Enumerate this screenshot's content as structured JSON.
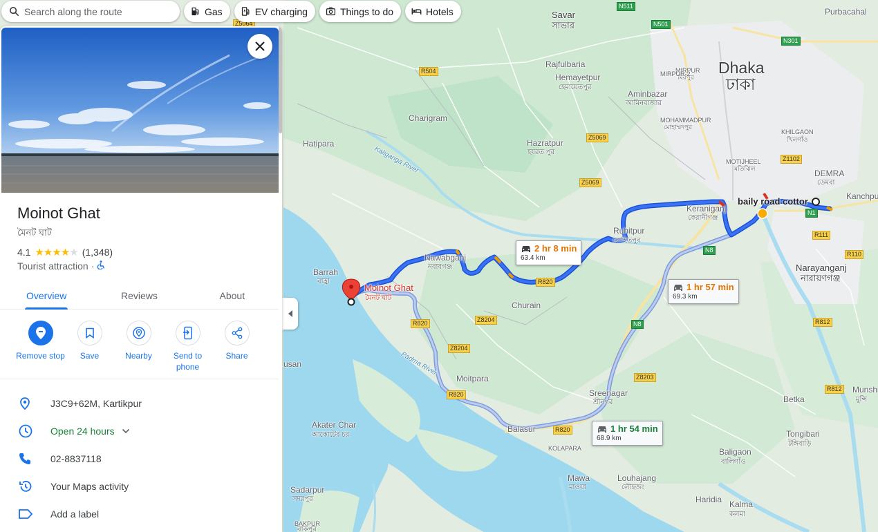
{
  "search": {
    "placeholder": "Search along the route"
  },
  "chips": [
    {
      "label": "Gas",
      "icon": "gas-station-icon"
    },
    {
      "label": "EV charging",
      "icon": "ev-charging-icon"
    },
    {
      "label": "Things to do",
      "icon": "camera-icon"
    },
    {
      "label": "Hotels",
      "icon": "bed-icon"
    }
  ],
  "place": {
    "title": "Moinot Ghat",
    "subtitle": "মৈনট ঘাট",
    "rating": "4.1",
    "stars": 4,
    "reviews_count": "(1,348)",
    "category": "Tourist attraction",
    "separator": "·"
  },
  "tabs": [
    {
      "label": "Overview",
      "active": true
    },
    {
      "label": "Reviews",
      "active": false
    },
    {
      "label": "About",
      "active": false
    }
  ],
  "actions": [
    {
      "label": "Remove stop",
      "icon": "remove-stop-icon"
    },
    {
      "label": "Save",
      "icon": "bookmark-icon"
    },
    {
      "label": "Nearby",
      "icon": "nearby-icon"
    },
    {
      "label": "Send to phone",
      "icon": "send-to-phone-icon"
    },
    {
      "label": "Share",
      "icon": "share-icon"
    }
  ],
  "info": {
    "address": "J3C9+62M, Kartikpur",
    "hours": "Open 24 hours",
    "phone": "02-8837118",
    "activity": "Your Maps activity",
    "label": "Add a label"
  },
  "routes": [
    {
      "time": "2 hr 8 min",
      "distance": "63.4 km"
    },
    {
      "time": "1 hr 57 min",
      "distance": "69.3 km"
    },
    {
      "time": "1 hr 54 min",
      "distance": "68.9 km"
    }
  ],
  "map": {
    "places": {
      "savar": "Savar",
      "savar_bn": "সাভার",
      "rajfulbaria": "Rajfulbaria",
      "hemayetpur": "Hemayetpur",
      "hemayetpur_bn": "হেমায়েতপুর",
      "aminbazar": "Aminbazar",
      "aminbazar_bn": "আমিনবাজার",
      "mohammadpur": "MOHAMMADPUR",
      "mohammadpur_bn": "মোহাম্মদপুর",
      "mirpur": "MIRPUR",
      "mirpur_bn": "মিরপুর",
      "mirpur2": "MIRPUR-2",
      "dhaka": "Dhaka",
      "dhaka_bn": "ঢাকা",
      "purbacahal": "Purbacahal",
      "khilgaon": "KHILGAON",
      "khilgaon_bn": "খিলগাঁও",
      "motijheel": "MOTIJHEEL",
      "motijheel_bn": "মতিঝিল",
      "demra": "DEMRA",
      "demra_bn": "ডেমরা",
      "kanchpur": "Kanchpu",
      "charigram": "Charigram",
      "hazratpur": "Hazratpur",
      "hazratpur_bn": "হযরত পুর",
      "hatipara": "Hatipara",
      "keraniganj": "Keraniganj",
      "keraniganj_bn": "কেরানীগঞ্জ",
      "baily": "baily road cottor",
      "ruhitpur": "Ruhitpur",
      "ruhitpur_bn": "রোহিতপুর",
      "nawabganj": "Nawabganj",
      "nawabganj_bn": "নবাবগঞ্জ",
      "barrah": "Barrah",
      "barrah_bn": "বাহ্রা",
      "moinot": "Moinot Ghat",
      "moinot_bn": "মৈনট ঘাট",
      "churain": "Churain",
      "narayanganj": "Narayanganj",
      "narayanganj_bn": "নারায়ণগঞ্জ",
      "moitpara": "Moitpara",
      "sreenagar": "Sreenagar",
      "sreenagar_bn": "শ্রীনগর",
      "betka": "Betka",
      "munshi": "Munshi",
      "munshi_bn": "মুন্সি",
      "akater": "Akater Char",
      "akater_bn": "আকোটের চর",
      "balasur": "Balasur",
      "kolapara": "KOLAPARA",
      "tongibari": "Tongibari",
      "tongibari_bn": "টঙ্গিবাড়ি",
      "baligaon": "Baligaon",
      "baligaon_bn": "বালিগাঁও",
      "mawa": "Mawa",
      "mawa_bn": "মাওয়া",
      "louhajang": "Louhajang",
      "louhajang_bn": "লৌহজং",
      "haridia": "Haridia",
      "kalma": "Kalma",
      "kalma_bn": "কলমা",
      "sadarpur": "Sadarpur",
      "sadarpur_bn": "সদরপুর",
      "bakpur": "BAKPUR",
      "bakpur_bn": "বাকপুর",
      "usan": "usan"
    },
    "rivers": {
      "kaliganga": "Kaliganga River",
      "padma": "Padma River"
    },
    "roads": {
      "z5064": "Z5064",
      "n511": "N511",
      "n501": "N501",
      "n301": "N301",
      "r504": "R504",
      "z5069a": "Z5069",
      "z5069b": "Z5069",
      "z1102": "Z1102",
      "n1": "N1",
      "n8a": "N8",
      "n8b": "N8",
      "r111": "R111",
      "r110": "R110",
      "r820a": "R820",
      "r820b": "R820",
      "r820c": "R820",
      "r820d": "R820",
      "z8204a": "Z8204",
      "z8204b": "Z8204",
      "z8203": "Z8203",
      "r812a": "R812",
      "r812b": "R812"
    }
  }
}
